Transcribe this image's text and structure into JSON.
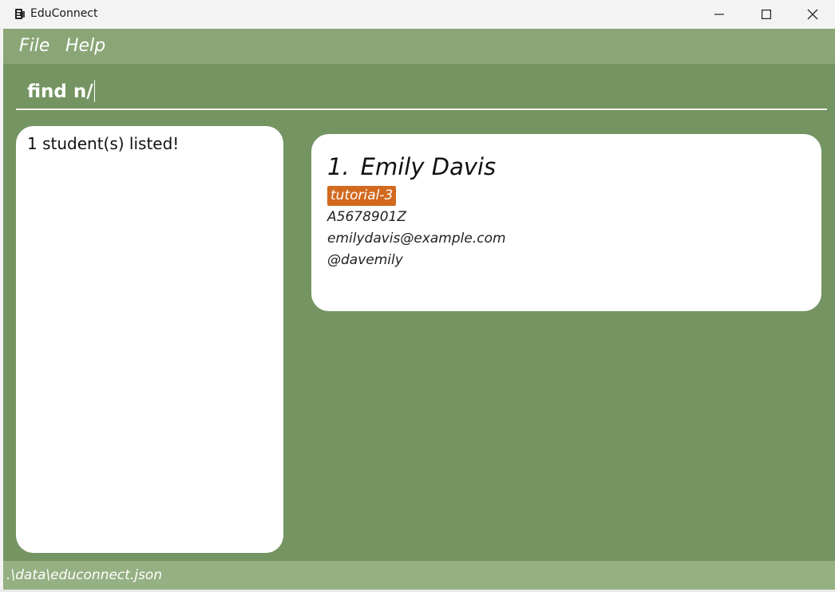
{
  "window": {
    "title": "EduConnect",
    "icon": "app-logo-icon",
    "controls": [
      "minimize-icon",
      "maximize-icon",
      "close-icon"
    ]
  },
  "menu": {
    "items": [
      {
        "label": "File"
      },
      {
        "label": "Help"
      }
    ]
  },
  "command": {
    "value": "find n/"
  },
  "result": {
    "message": "1 student(s) listed!"
  },
  "students": [
    {
      "index": "1.",
      "name": "Emily Davis",
      "tag": "tutorial-3",
      "student_id": "A5678901Z",
      "email": "emilydavis@example.com",
      "telegram": "@davemily"
    }
  ],
  "status": {
    "file_path": ".\\data\\educonnect.json"
  },
  "colors": {
    "menubar": "#8aa676",
    "main_bg": "#749461",
    "statusbar": "#95b083",
    "tag_bg": "#d2691e"
  }
}
